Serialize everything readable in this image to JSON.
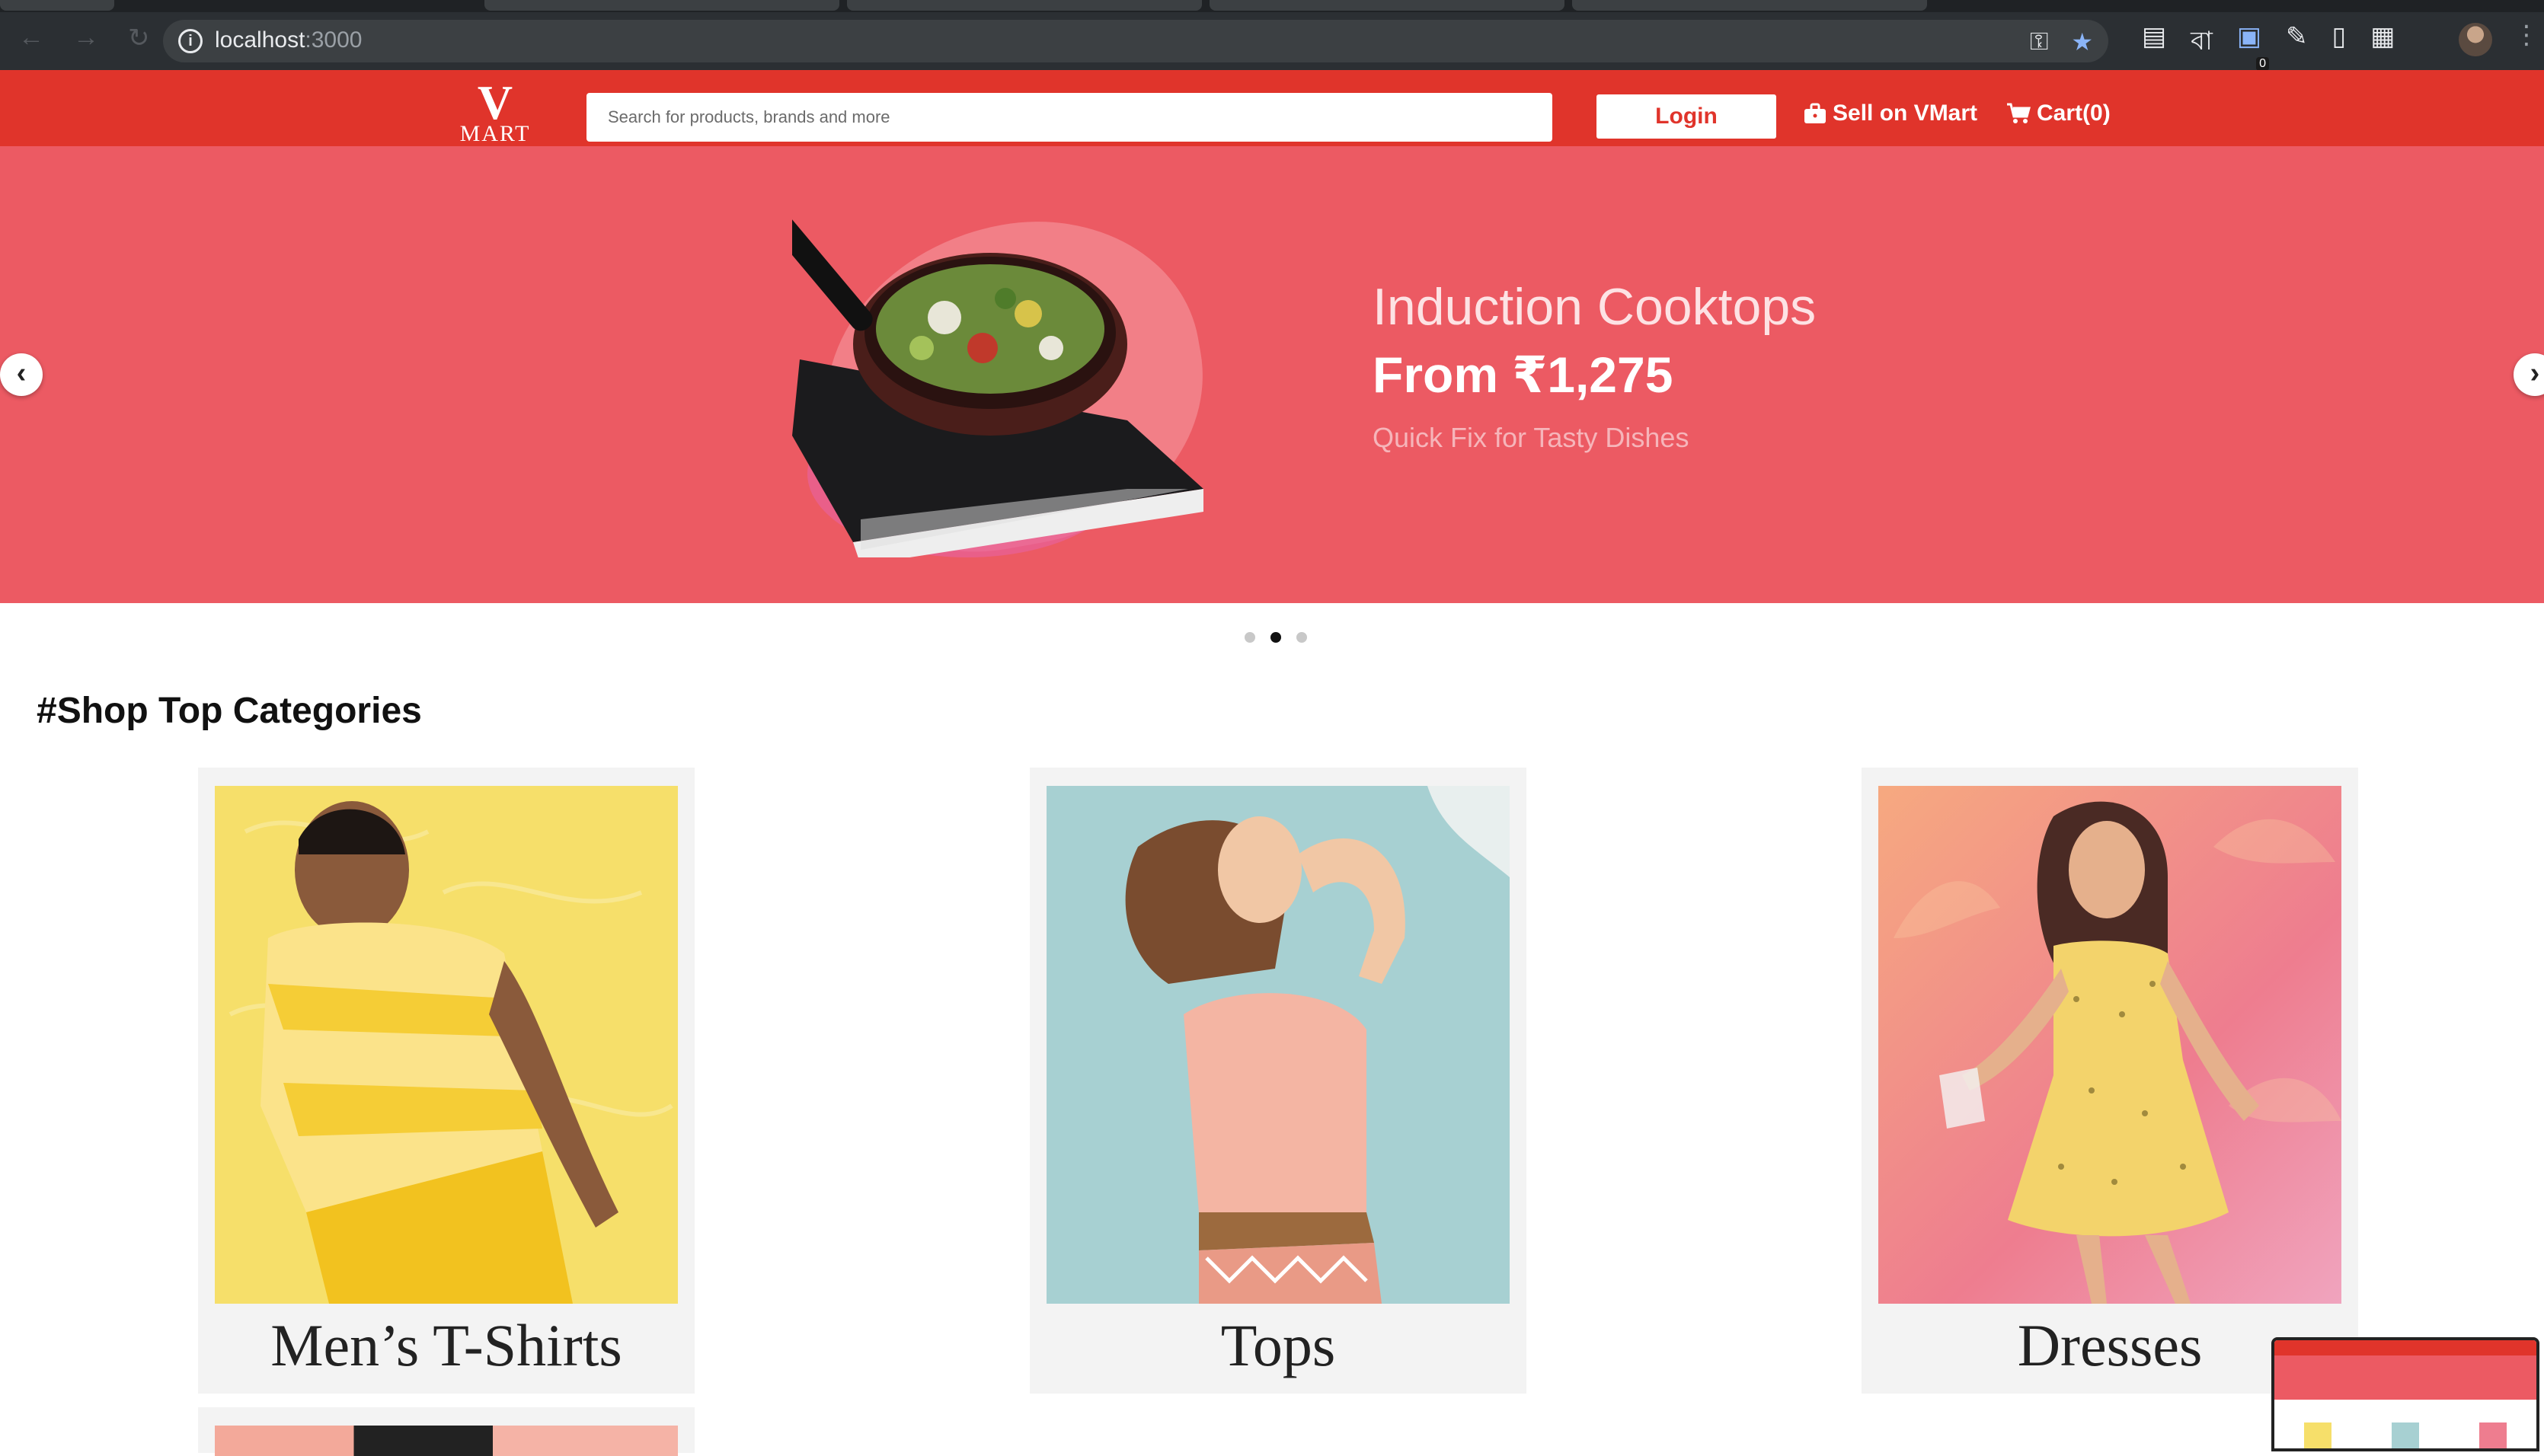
{
  "browser": {
    "url_host": "localhost",
    "url_port": ":3000",
    "extension_badge": "0"
  },
  "header": {
    "logo_letter": "V",
    "logo_text": "MART",
    "search_placeholder": "Search for products, brands and more",
    "login_label": "Login",
    "sell_label": "Sell on VMart",
    "cart_label": "Cart(0)"
  },
  "banner": {
    "title": "Induction Cooktops",
    "price": "From ₹1,275",
    "subtitle": "Quick Fix for Tasty Dishes",
    "slide_count": 3,
    "active_slide": 2
  },
  "section": {
    "title": "#Shop Top Categories"
  },
  "categories": [
    {
      "label": "Men’s T-Shirts"
    },
    {
      "label": "Tops"
    },
    {
      "label": "Dresses"
    }
  ],
  "colors": {
    "brand_red": "#e0342b",
    "banner_bg": "#ec5a63"
  }
}
